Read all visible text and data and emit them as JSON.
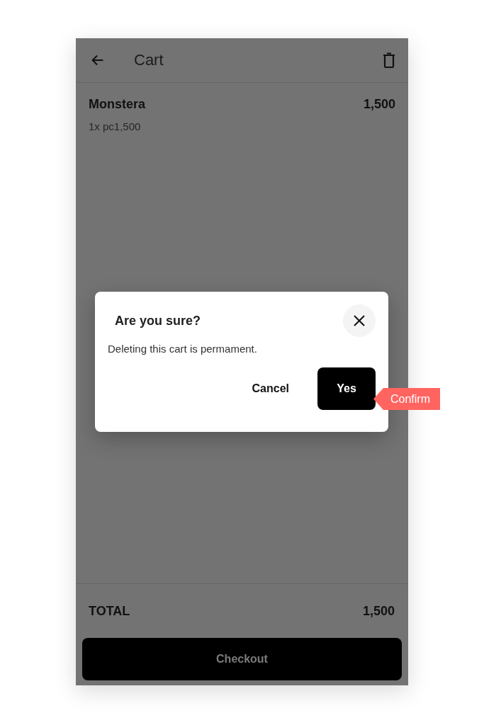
{
  "header": {
    "title": "Cart"
  },
  "items": [
    {
      "name": "Monstera",
      "quantity": "1x pc1,500",
      "price": "1,500"
    }
  ],
  "total": {
    "label": "TOTAL",
    "value": "1,500"
  },
  "checkout_button": "Checkout",
  "dialog": {
    "title": "Are you sure?",
    "message": "Deleting this cart is permament.",
    "cancel": "Cancel",
    "confirm": "Yes"
  },
  "annotation": {
    "label": "Confirm"
  }
}
